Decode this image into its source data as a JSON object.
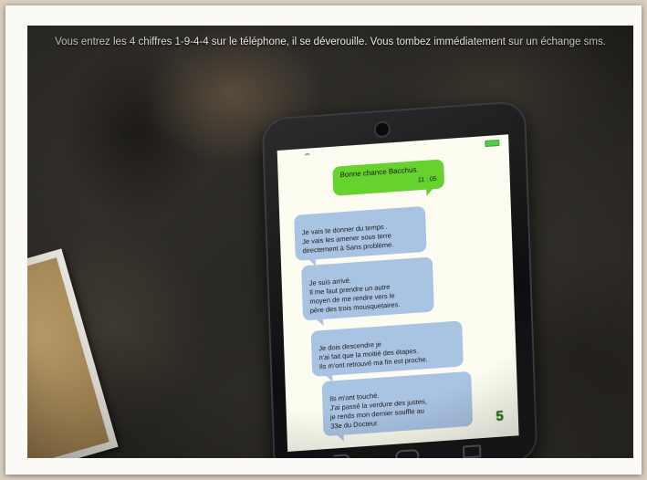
{
  "narration": "Vous entrez les 4 chiffres 1-9-4-4 sur le téléphone, il se déverouille. Vous tombez immédiatement sur un échange sms.",
  "phone": {
    "messages": [
      {
        "type": "out",
        "text": "Bonne chance Bacchus.",
        "time": "11 : 05"
      },
      {
        "type": "in",
        "text": "Je vais te donner du temps .\nJe vais les amener sous terre\ndirectement à Sans problème."
      },
      {
        "type": "in",
        "text": "Je suis arrivé.\nIl me faut prendre un autre\nmoyen de me rendre vers le\npère des trois mousquetaires."
      },
      {
        "type": "in",
        "text": "Je dois descendre je\nn'ai fait que la moitié des étapes.\nIls m'ont retrouvé ma fin est proche."
      },
      {
        "type": "in",
        "text": "Ils m'ont touché.\nJ'ai passé la verdure des justes,\nje rends mon dernier souffle au\n33e du Docteur."
      }
    ],
    "page_number": "5"
  },
  "icons": {
    "wifi": "wifi-icon",
    "battery": "battery-icon",
    "back": "nav-back-icon",
    "home": "nav-home-icon",
    "recent": "nav-recent-icon"
  },
  "colors": {
    "outgoing_bubble": "#66d22e",
    "incoming_bubble": "#a9c3e3",
    "screen": "#fdfcf0",
    "page_number": "#2f7d1e"
  }
}
